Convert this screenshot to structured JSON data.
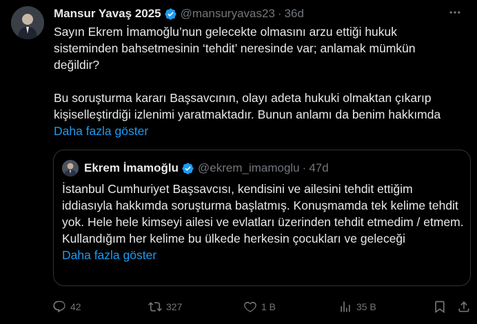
{
  "tweet": {
    "author_name": "Mansur Yavaş 2025",
    "handle": "@mansuryavas23",
    "separator": "·",
    "time": "36d",
    "text_p1": "Sayın Ekrem İmamoğlu’nun gelecekte olmasını arzu ettiği hukuk sisteminden bahsetmesinin ‘tehdit’ neresinde var; anlamak mümkün değildir?",
    "text_p2": "Bu soruşturma kararı Başsavcının, olayı adeta hukuki olmaktan çıkarıp kişiselleştirdiği izlenimi yaratmaktadır. Bunun anlamı da benim hakkımda",
    "show_more": "Daha fazla göster"
  },
  "quoted": {
    "author_name": "Ekrem İmamoğlu",
    "handle": "@ekrem_imamoglu",
    "separator": "·",
    "time": "47d",
    "text": "İstanbul Cumhuriyet Başsavcısı, kendisini ve ailesini tehdit ettiğim iddiasıyla hakkımda soruşturma başlatmış. Konuşmamda tek kelime tehdit yok. Hele hele kimseyi ailesi ve evlatları üzerinden tehdit etmedim / etmem. Kullandığım her kelime bu ülkede herkesin çocukları ve geleceği",
    "show_more": "Daha fazla göster"
  },
  "actions": {
    "replies": "42",
    "reposts": "327",
    "likes": "1 B",
    "views": "35 B"
  },
  "colors": {
    "background": "#000000",
    "text": "#e7e9ea",
    "muted": "#71767b",
    "link": "#1d9bf0",
    "verified": "#1d9bf0",
    "border": "#2f3336"
  },
  "icons": [
    "verified-badge-icon",
    "more-options-icon",
    "reply-icon",
    "repost-icon",
    "like-icon",
    "views-icon",
    "bookmark-icon",
    "share-icon"
  ]
}
